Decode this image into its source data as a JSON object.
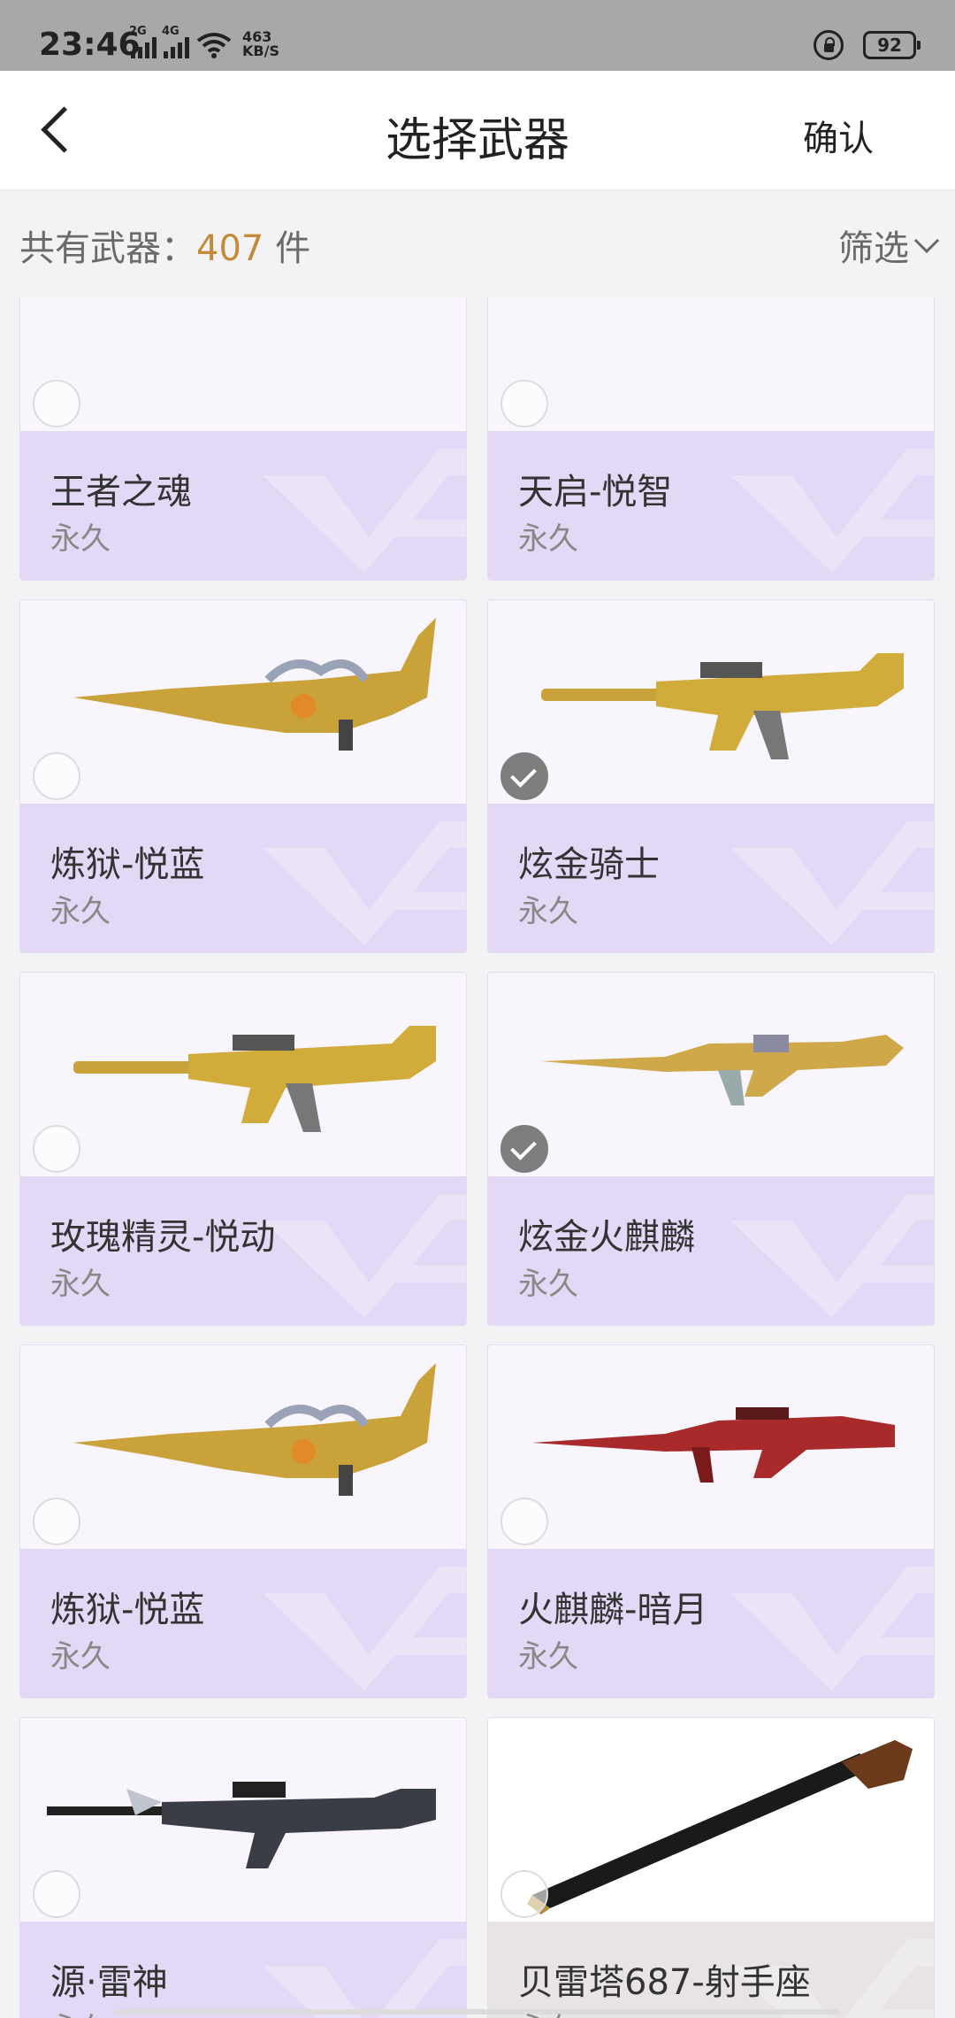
{
  "status": {
    "time": "23:46",
    "sim1": "2G",
    "sim2": "4G",
    "speed_value": "463",
    "speed_unit": "KB/S",
    "battery": "92"
  },
  "header": {
    "title": "选择武器",
    "confirm_label": "确认"
  },
  "summary": {
    "prefix": "共有武器：",
    "count": "407",
    "suffix": " 件",
    "filter_label": "筛选"
  },
  "weapons": [
    {
      "name": "王者之魂",
      "duration": "永久",
      "selected": false,
      "gun_type": "knife-gold"
    },
    {
      "name": "天启-悦智",
      "duration": "永久",
      "selected": false,
      "gun_type": "knife-gold"
    },
    {
      "name": "炼狱-悦蓝",
      "duration": "永久",
      "selected": false,
      "gun_type": "dragon-gold"
    },
    {
      "name": "炫金骑士",
      "duration": "永久",
      "selected": true,
      "gun_type": "rifle-gold"
    },
    {
      "name": "玫瑰精灵-悦动",
      "duration": "永久",
      "selected": false,
      "gun_type": "rifle-gold"
    },
    {
      "name": "炫金火麒麟",
      "duration": "永久",
      "selected": true,
      "gun_type": "ak-gold"
    },
    {
      "name": "炼狱-悦蓝",
      "duration": "永久",
      "selected": false,
      "gun_type": "dragon-gold"
    },
    {
      "name": "火麒麟-暗月",
      "duration": "永久",
      "selected": false,
      "gun_type": "ak-red"
    },
    {
      "name": "源·雷神",
      "duration": "永久",
      "selected": false,
      "gun_type": "rifle-dark"
    },
    {
      "name": "贝雷塔687-射手座",
      "duration": "永久",
      "selected": false,
      "gun_type": "shotgun-black"
    }
  ]
}
